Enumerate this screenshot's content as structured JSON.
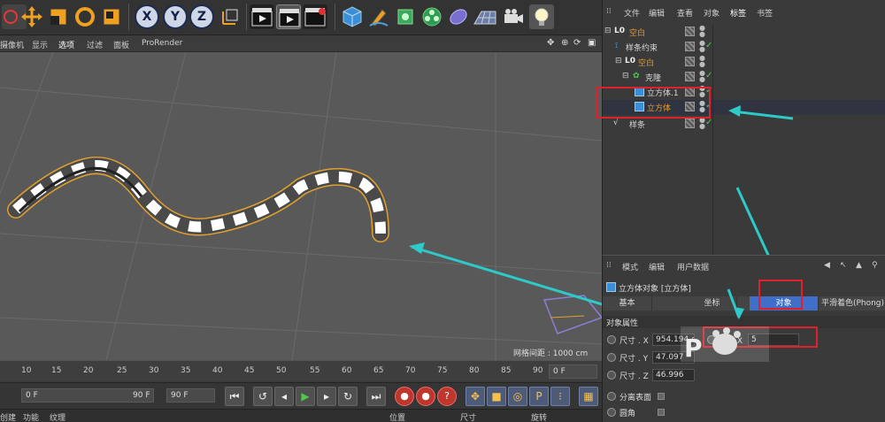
{
  "viewport_menu": [
    "摄像机",
    "显示",
    "选项",
    "过滤",
    "面板",
    "ProRender"
  ],
  "toolbar": {
    "x_label": "X",
    "y_label": "Y",
    "z_label": "Z"
  },
  "viewport": {
    "grid_spacing": "网格间距 : 1000 cm"
  },
  "timeline": {
    "ticks": [
      "10",
      "15",
      "20",
      "25",
      "30",
      "35",
      "40",
      "45",
      "50",
      "55",
      "60",
      "65",
      "70",
      "75",
      "80",
      "85",
      "90"
    ],
    "end_frame": "0 F",
    "start_field": "0 F",
    "end_field": "90 F",
    "max_field": "90 F"
  },
  "bottom_bar": {
    "left_items": [
      "创建",
      "功能",
      "纹理"
    ],
    "right_items": [
      "位置",
      "尺寸",
      "旋转"
    ]
  },
  "object_manager": {
    "menu": [
      "文件",
      "编辑",
      "查看",
      "对象",
      "标签",
      "书签"
    ],
    "rows": [
      {
        "name": "空白",
        "color": "orange"
      },
      {
        "name": "样条约束",
        "color": "normal"
      },
      {
        "name": "空白",
        "color": "orange"
      },
      {
        "name": "克隆",
        "color": "normal"
      },
      {
        "name": "立方体.1",
        "color": "normal"
      },
      {
        "name": "立方体",
        "color": "orange"
      },
      {
        "name": "样条",
        "color": "normal"
      }
    ]
  },
  "attribute_manager": {
    "menu": [
      "模式",
      "编辑",
      "用户数据"
    ],
    "title": "立方体对象 [立方体]",
    "tabs": [
      "基本",
      "坐标",
      "对象",
      "平滑着色(Phong)"
    ],
    "active_tab": "对象",
    "section": "对象属性",
    "props": [
      {
        "label": "尺寸 . X",
        "value": "954.194 c"
      },
      {
        "label": "尺寸 . Y",
        "value": "47.097"
      },
      {
        "label": "尺寸 . Z",
        "value": "46.996"
      },
      {
        "label": "分离表面",
        "value": ""
      },
      {
        "label": "圆角",
        "value": ""
      }
    ],
    "segment_label": "分段 X",
    "segment_value": "5"
  },
  "colors": {
    "highlight_red": "#e0202a",
    "annotation_cyan": "#2ec9c9",
    "active_tab_blue": "#3f6fc8",
    "object_orange": "#e89b2c"
  }
}
